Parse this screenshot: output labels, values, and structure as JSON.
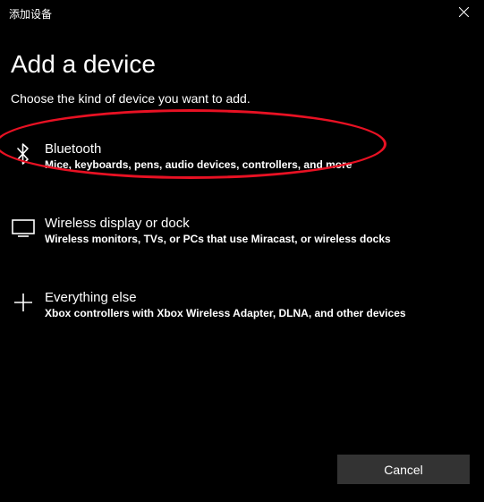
{
  "titlebar": {
    "title": "添加设备"
  },
  "header": {
    "heading": "Add a device",
    "subheading": "Choose the kind of device you want to add."
  },
  "options": {
    "bluetooth": {
      "title": "Bluetooth",
      "desc": "Mice, keyboards, pens, audio devices, controllers, and more"
    },
    "wireless": {
      "title": "Wireless display or dock",
      "desc": "Wireless monitors, TVs, or PCs that use Miracast, or wireless docks"
    },
    "everything": {
      "title": "Everything else",
      "desc": "Xbox controllers with Xbox Wireless Adapter, DLNA, and other devices"
    }
  },
  "footer": {
    "cancel_label": "Cancel"
  },
  "annotation": {
    "highlight_color": "#e81123"
  }
}
